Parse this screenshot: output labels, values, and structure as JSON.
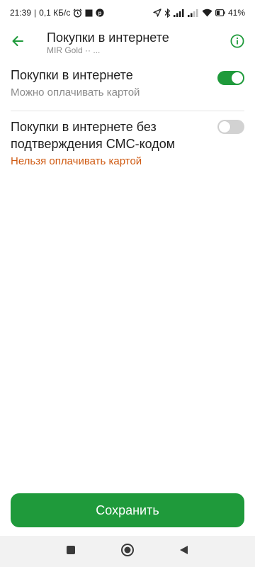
{
  "status_bar": {
    "time": "21:39",
    "separator": "|",
    "net_speed": "0,1 КБ/с",
    "battery": "41"
  },
  "header": {
    "title": "Покупки в интернете",
    "subtitle": "MIR Gold ·· ..."
  },
  "settings": [
    {
      "title": "Покупки в интернете",
      "subtitle": "Можно оплачивать картой",
      "enabled": true
    },
    {
      "title": "Покупки в интернете без подтверждения СМС-кодом",
      "subtitle": "Нельзя оплачивать картой",
      "enabled": false
    }
  ],
  "save_label": "Сохранить",
  "colors": {
    "accent": "#1f9a3b",
    "warning_text": "#cf5a12",
    "muted_text": "#8a8a8a",
    "toggle_off": "#d2d2d2"
  },
  "icons": {
    "back": "arrow-left-icon",
    "info": "info-circle-icon",
    "nav_recent": "square-icon",
    "nav_home": "circle-icon",
    "nav_back": "triangle-back-icon"
  }
}
